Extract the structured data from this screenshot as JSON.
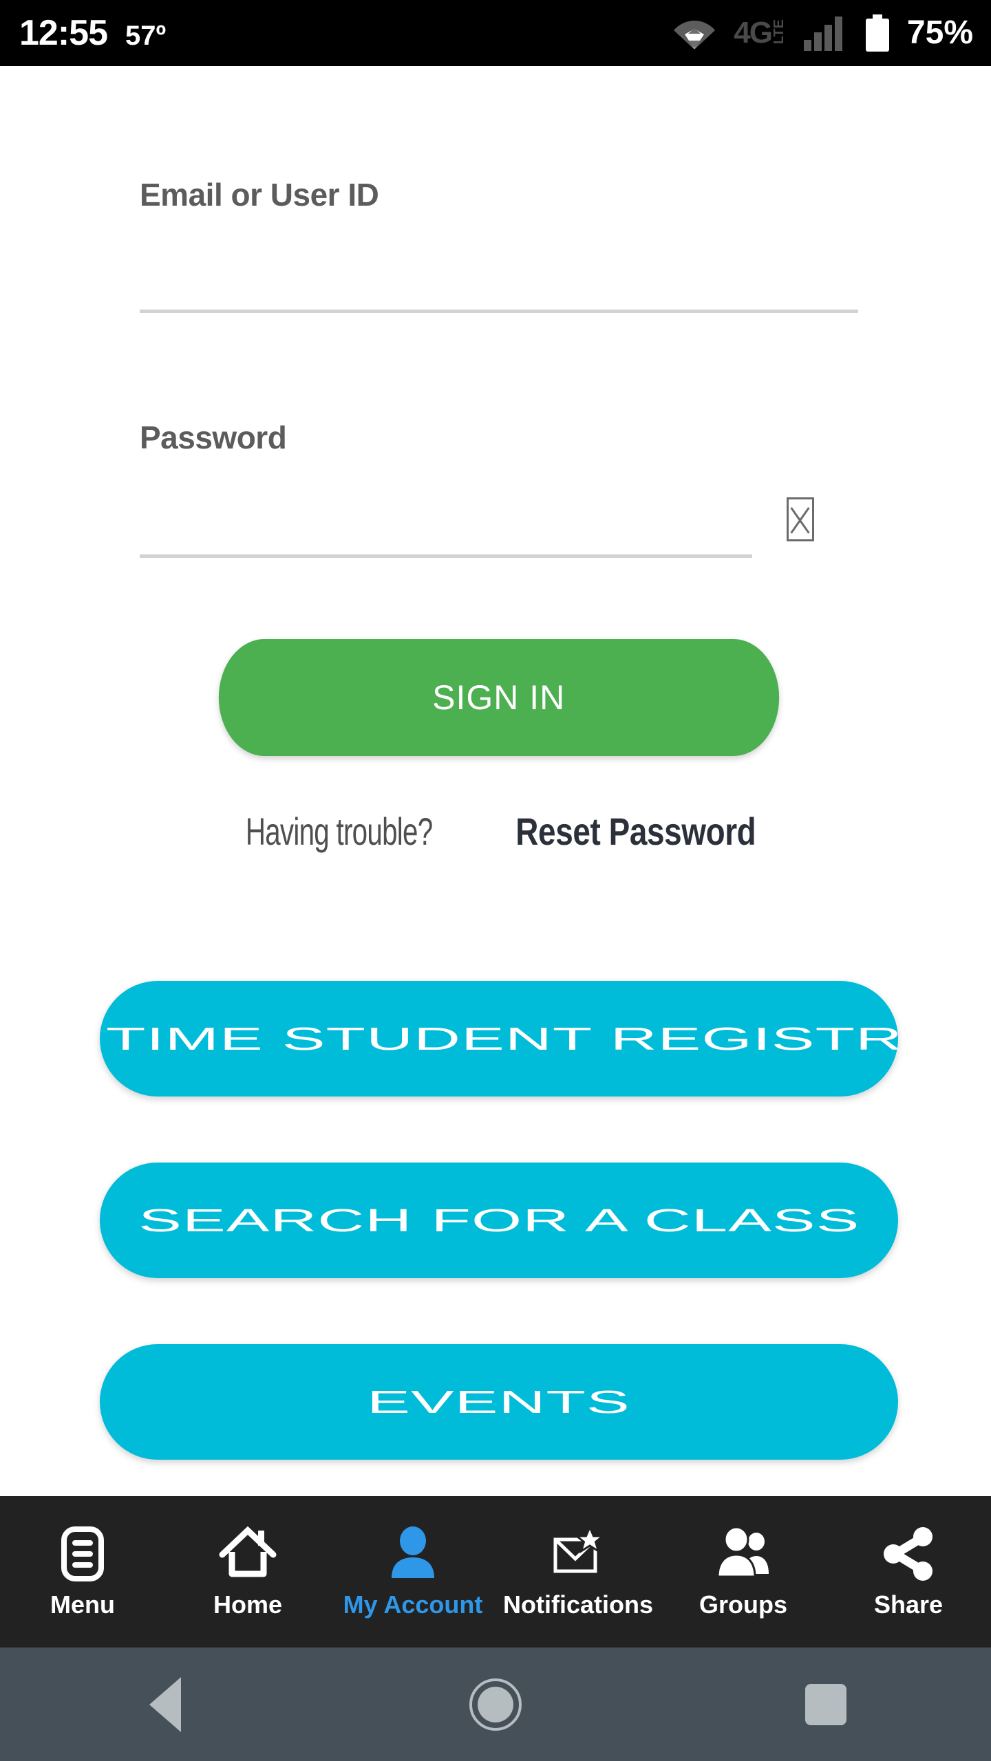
{
  "status_bar": {
    "time": "12:55",
    "temperature": "57º",
    "wifi_icon": "wifi-icon",
    "network_label": "4G",
    "network_tech": "LTE",
    "signal_icon": "signal-bars-icon",
    "battery_icon": "battery-icon",
    "battery_percent": "75%"
  },
  "form": {
    "email": {
      "label": "Email or User ID",
      "value": "",
      "placeholder": ""
    },
    "password": {
      "label": "Password",
      "value": "",
      "placeholder": "",
      "toggle_icon": "missing-glyph-box-icon"
    },
    "sign_in_label": "SIGN IN"
  },
  "help": {
    "text": "Having trouble?",
    "link_label": "Reset Password"
  },
  "actions": [
    {
      "label": "FIRST TIME STUDENT REGISTRATION"
    },
    {
      "label": "SEARCH FOR A CLASS"
    },
    {
      "label": "EVENTS"
    }
  ],
  "bottom_nav": {
    "items": [
      {
        "label": "Menu",
        "icon": "menu-list-icon",
        "active": false
      },
      {
        "label": "Home",
        "icon": "home-icon",
        "active": false
      },
      {
        "label": "My Account",
        "icon": "person-icon",
        "active": true
      },
      {
        "label": "Notifications",
        "icon": "envelope-star-icon",
        "active": false
      },
      {
        "label": "Groups",
        "icon": "people-group-icon",
        "active": false
      },
      {
        "label": "Share",
        "icon": "share-nodes-icon",
        "active": false
      }
    ]
  },
  "system_bar": {
    "back_icon": "back-triangle-icon",
    "home_icon": "home-circle-icon",
    "recents_icon": "recents-square-icon"
  },
  "colors": {
    "primary_green": "#4caf50",
    "accent_cyan": "#00bcd8",
    "active_blue": "#2f97e8",
    "nav_background": "#222222",
    "system_bar": "#465058"
  }
}
